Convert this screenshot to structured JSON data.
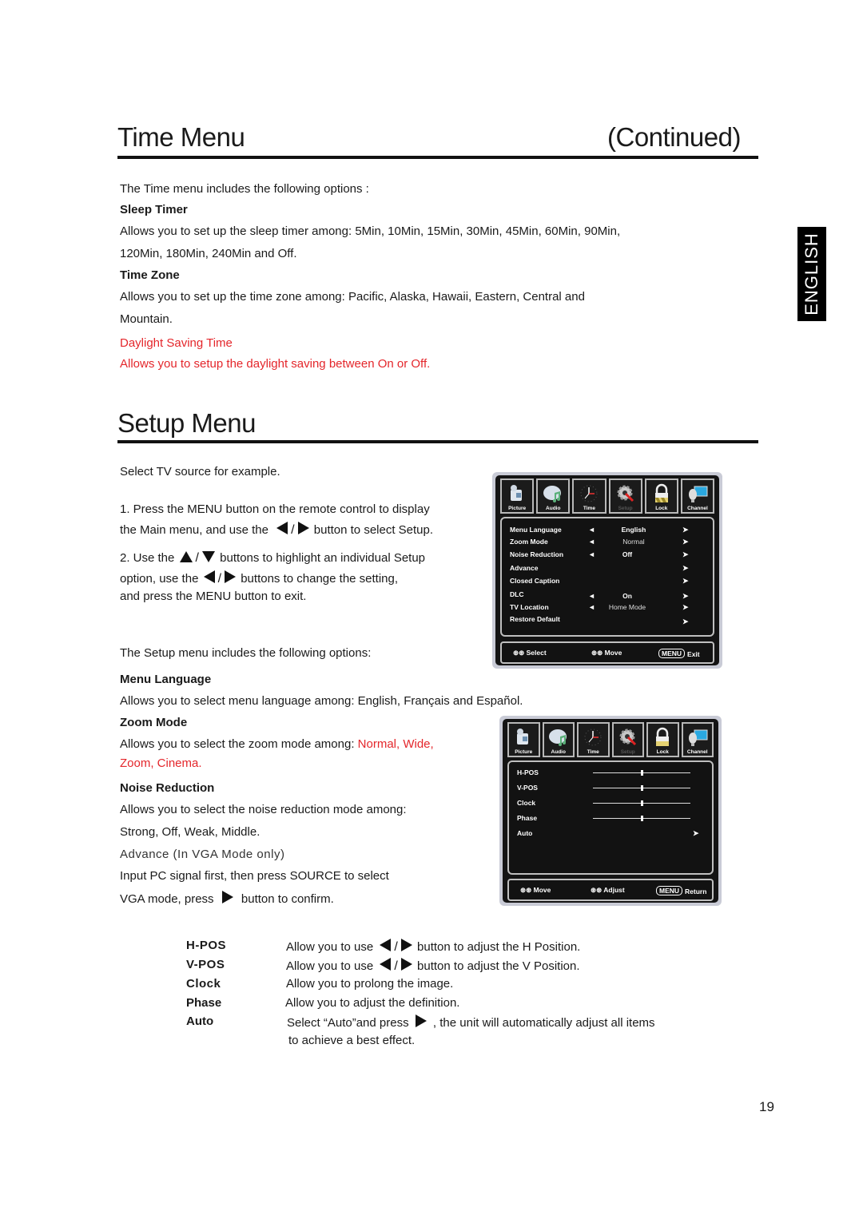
{
  "time_menu": {
    "title": "Time Menu",
    "continued": "(Continued)",
    "intro": "The Time menu includes the following options :",
    "sleep_timer": {
      "heading": "Sleep Timer",
      "line1": "Allows you to set up the sleep timer among: 5Min, 10Min, 15Min, 30Min, 45Min, 60Min, 90Min,",
      "line2": "120Min, 180Min, 240Min and Off."
    },
    "time_zone": {
      "heading": "Time Zone",
      "line1": "Allows you to set up the time zone  among: Pacific, Alaska,  Hawaii, Eastern, Central and",
      "line2": "Mountain."
    },
    "daylight_saving": {
      "heading": "Daylight Saving Time",
      "line1": "Allows you to setup the daylight saving between On or Off."
    }
  },
  "side_tab": {
    "label": "ENGLISH"
  },
  "setup_menu": {
    "title": "Setup Menu",
    "intro": "Select TV source for example.",
    "step1_a": "1. Press the MENU button on the remote control to display",
    "step1_b_pre": "the Main menu, and use the",
    "step1_b_post": "button to select Setup.",
    "step2_a_pre": "2. Use the",
    "step2_a_post": "buttons to highlight an individual Setup",
    "step2_b_pre": "option, use the",
    "step2_b_post": "buttons to change the setting,",
    "step2_c": "and press the MENU button to exit.",
    "options_intro": "The Setup menu includes the following options:",
    "menu_language": {
      "heading": "Menu Language",
      "line1": "Allows you to select menu language among: English, Français and Español."
    },
    "zoom_mode": {
      "heading": "Zoom Mode",
      "line1_pre": "Allows you to select the zoom mode among:",
      "line1_red": "Normal, Wide,",
      "line2_red": "Zoom, Cinema."
    },
    "noise_reduction": {
      "heading": "Noise Reduction",
      "line1": "Allows you to select the noise reduction mode among:",
      "line2": "Strong, Off, Weak, Middle."
    },
    "advance": {
      "heading": "Advance (In VGA Mode only)",
      "line1": "Input PC signal first, then press SOURCE to select",
      "line2_pre": "VGA mode, press",
      "line2_post": "button to confirm."
    },
    "slash": "/"
  },
  "osd_tabs": [
    "Picture",
    "Audio",
    "Time",
    "Setup",
    "Lock",
    "Channel"
  ],
  "osd1": {
    "rows": [
      {
        "label": "Menu  Language",
        "value": "English",
        "left": "◄",
        "right": "➤"
      },
      {
        "label": "Zoom  Mode",
        "value": "Normal",
        "left": "◄",
        "right": "➤"
      },
      {
        "label": "Noise  Reduction",
        "value": "Off",
        "left": "◄",
        "right": "➤"
      },
      {
        "label": "Advance",
        "value": "",
        "left": "",
        "right": "➤"
      },
      {
        "label": "Closed Caption",
        "value": "",
        "left": "",
        "right": "➤"
      },
      {
        "label": "DLC",
        "value": "On",
        "left": "◄",
        "right": "➤"
      },
      {
        "label": "TV Location",
        "value": "Home Mode",
        "left": "◄",
        "right": "➤"
      },
      {
        "label": "Restore Default",
        "value": "",
        "left": "",
        "right": "➤"
      }
    ],
    "footer": {
      "select": "Select",
      "move": "Move",
      "menu_key": "MENU",
      "exit": "Exit",
      "updown": "⓿⓿",
      "leftright": "⓿⓿"
    }
  },
  "osd2": {
    "rows": [
      {
        "label": "H-POS",
        "level": 0.5
      },
      {
        "label": "V-POS",
        "level": 0.5
      },
      {
        "label": "Clock",
        "level": 0.5
      },
      {
        "label": "Phase",
        "level": 0.5
      }
    ],
    "auto_label": "Auto",
    "auto_arrow": "➤",
    "footer": {
      "move": "Move",
      "adjust": "Adjust",
      "menu_key": "MENU",
      "return": "Return"
    }
  },
  "vga_table": [
    {
      "key": "H-POS",
      "pre": "Allow you to use",
      "post": "button to adjust the H Position."
    },
    {
      "key": "V-POS",
      "pre": "Allow you to use",
      "post": "button to adjust the V Position."
    },
    {
      "key": "Clock",
      "pre": "Allow you to prolong the image.",
      "post": ""
    },
    {
      "key": "Phase",
      "pre": "Allow you to adjust the definition.",
      "post": ""
    },
    {
      "key": "Auto",
      "pre": "Select “Auto”and press",
      "post": ", the unit will automatically adjust all items"
    }
  ],
  "vga_auto_line2": "to achieve a best effect.",
  "page_number": "19",
  "colors": {
    "accent_red": "#e4262b",
    "osd_bg": "#141414",
    "osd_frame": "#c9cbd6"
  }
}
